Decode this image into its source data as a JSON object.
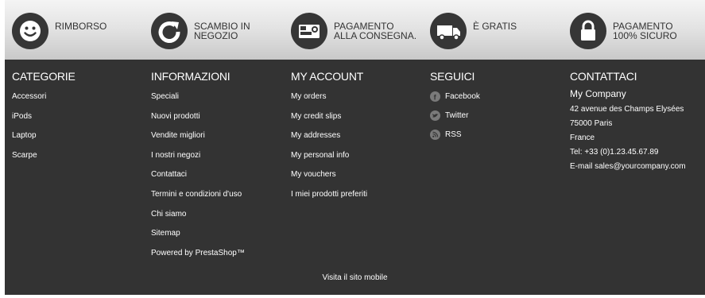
{
  "features": [
    {
      "label": "RIMBORSO",
      "icon": "smiley-icon"
    },
    {
      "label": "SCAMBIO IN\nNEGOZIO",
      "icon": "refresh-icon"
    },
    {
      "label": "PAGAMENTO\nALLA CONSEGNA.",
      "icon": "credit-card-icon"
    },
    {
      "label": "È GRATIS",
      "icon": "truck-icon"
    },
    {
      "label": "PAGAMENTO\n100% SICURO",
      "icon": "lock-icon"
    }
  ],
  "categorie": {
    "title": "CATEGORIE",
    "items": [
      "Accessori",
      "iPods",
      "Laptop",
      "Scarpe"
    ]
  },
  "informazioni": {
    "title": "INFORMAZIONI",
    "items": [
      "Speciali",
      "Nuovi prodotti",
      "Vendite migliori",
      "I nostri negozi",
      "Contattaci",
      "Termini e condizioni d'uso",
      "Chi siamo",
      "Sitemap",
      "Powered by PrestaShop™"
    ]
  },
  "account": {
    "title": "MY ACCOUNT",
    "items": [
      "My orders",
      "My credit slips",
      "My addresses",
      "My personal info",
      "My vouchers",
      "I miei prodotti preferiti"
    ]
  },
  "seguici": {
    "title": "SEGUICI",
    "items": [
      {
        "label": "Facebook",
        "icon": "facebook-icon"
      },
      {
        "label": "Twitter",
        "icon": "twitter-icon"
      },
      {
        "label": "RSS",
        "icon": "rss-icon"
      }
    ]
  },
  "contattaci": {
    "title": "CONTATTACI",
    "company": "My Company",
    "address1": "42 avenue des Champs Elysées",
    "address2": "75000 Paris",
    "country": "France",
    "tel": "Tel: +33 (0)1.23.45.67.89",
    "email": "E-mail sales@yourcompany.com"
  },
  "mobile_link": "Visita il sito mobile"
}
